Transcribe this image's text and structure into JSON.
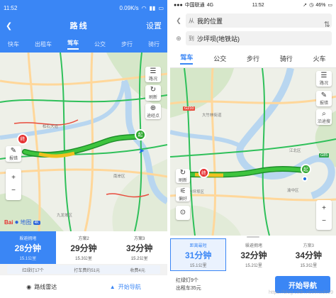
{
  "left": {
    "status": {
      "time": "11:52",
      "speed": "0.09K/s"
    },
    "title": "路线",
    "settings_label": "设置",
    "tabs": [
      "快车",
      "出租车",
      "驾车",
      "公交",
      "步行",
      "骑行"
    ],
    "active_tab": 2,
    "map": {
      "labels": [
        "松石大道",
        "南岸区",
        "九龙坡区"
      ],
      "controls": {
        "traffic": "路况",
        "refresh": "刷新",
        "via": "途经点",
        "report": "报错"
      },
      "start_marker": "起",
      "end_marker": "终",
      "logo_text": "Bai",
      "logo_suffix": "地图",
      "logo_badge": "4K"
    },
    "routes": [
      {
        "tag": "躲避拥堵",
        "duration": "28分钟",
        "distance": "15.1公里"
      },
      {
        "tag": "方案2",
        "duration": "29分钟",
        "distance": "15.3公里"
      },
      {
        "tag": "方案3",
        "duration": "32分钟",
        "distance": "15.2公里"
      }
    ],
    "active_route": 0,
    "info": [
      "红绿灯17个",
      "打车费约51元",
      "收费4元"
    ],
    "bottom": {
      "simulate": "路线雷达",
      "navigate": "开始导航"
    }
  },
  "right": {
    "status": {
      "carrier": "中国联通",
      "network": "4G",
      "time": "11:52",
      "battery": "46%"
    },
    "from_label": "从",
    "from_value": "我的位置",
    "to_label": "到",
    "to_value": "沙坪坝(地铁站)",
    "tabs": [
      "驾车",
      "公交",
      "步行",
      "骑行",
      "火车"
    ],
    "active_tab": 0,
    "map": {
      "labels": [
        "大竹林街道",
        "江北区",
        "沙坪坝区",
        "渝中区",
        "G210",
        "G85"
      ],
      "controls": {
        "traffic": "路况",
        "report": "报错",
        "via": "沿途搜",
        "refresh": "刷新",
        "preference": "偏好"
      },
      "start_marker": "起",
      "end_marker": "终"
    },
    "routes": [
      {
        "tag": "距离最短",
        "duration": "31分钟",
        "distance": "15.1公里"
      },
      {
        "tag": "躲避拥堵",
        "duration": "32分钟",
        "distance": "15.2公里"
      },
      {
        "tag": "方案3",
        "duration": "34分钟",
        "distance": "15.3公里"
      }
    ],
    "active_route": 0,
    "summary": {
      "lights": "红绿灯9个",
      "taxi": "出租车35元"
    },
    "start_button": "开始导航",
    "watermark": "https://blog.csdn.net/lmsd009"
  },
  "colors": {
    "accent": "#3a86f5",
    "route": "#3ec43e",
    "jam": "#f0c020",
    "marker_start": "#2ea82e",
    "marker_end": "#e53030"
  }
}
